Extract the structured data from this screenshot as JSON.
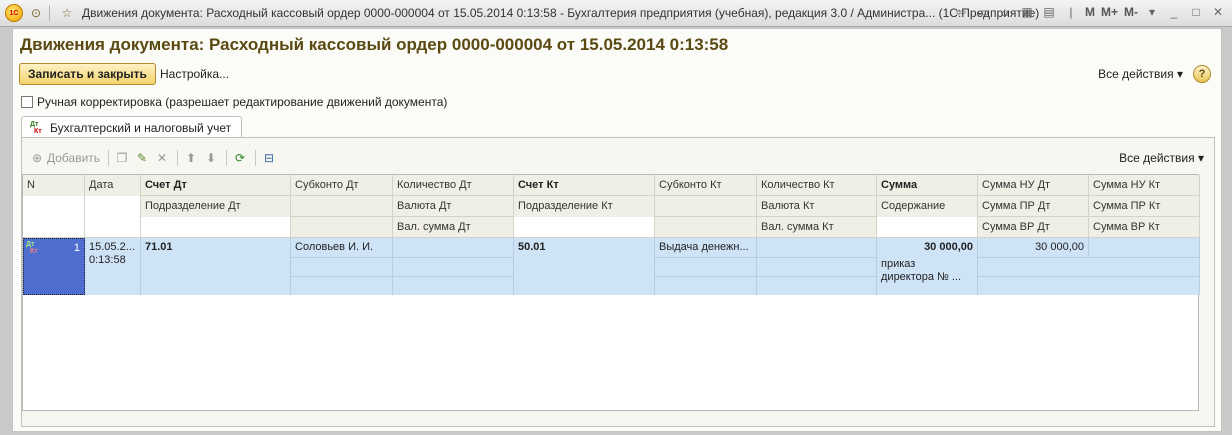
{
  "titlebar": {
    "title": "Движения документа: Расходный кассовый ордер 0000-000004 от 15.05.2014 0:13:58 - Бухгалтерия предприятия (учебная), редакция 3.0 / Администра...",
    "app": "(1С:Предприятие)",
    "logo_text": "1С",
    "m_labels": [
      "M",
      "M+",
      "M-"
    ]
  },
  "window": {
    "doc_title": "Движения документа: Расходный кассовый ордер 0000-000004 от 15.05.2014 0:13:58",
    "save_close": "Записать и закрыть",
    "settings": "Настройка...",
    "all_actions": "Все действия",
    "help": "?",
    "manual_correction": "Ручная корректировка (разрешает редактирование движений документа)",
    "tab_label": "Бухгалтерский и налоговый учет"
  },
  "toolbar": {
    "add": "Добавить",
    "all_actions": "Все действия"
  },
  "grid": {
    "headers_row1": [
      "N",
      "Дата",
      "Счет Дт",
      "Субконто Дт",
      "Количество Дт",
      "Счет Кт",
      "Субконто Кт",
      "Количество Кт",
      "Сумма",
      "Сумма НУ Дт",
      "Сумма НУ Кт"
    ],
    "headers_row2": [
      "Подразделение Дт",
      "Валюта Дт",
      "Подразделение Кт",
      "Валюта Кт",
      "Содержание",
      "Сумма ПР Дт",
      "Сумма ПР Кт"
    ],
    "headers_row3": [
      "Вал. сумма Дт",
      "Вал. сумма Кт",
      "Сумма ВР Дт",
      "Сумма ВР Кт"
    ],
    "rows": [
      {
        "n": "1",
        "date": "15.05.2...",
        "time": "0:13:58",
        "account_dt": "71.01",
        "subconto_dt": "Соловьев И. И.",
        "account_kt": "50.01",
        "subconto_kt": "Выдача денежн...",
        "sum": "30 000,00",
        "content_line1": "приказ",
        "content_line2": "директора № ...",
        "sum_nu_dt": "30 000,00"
      }
    ]
  }
}
